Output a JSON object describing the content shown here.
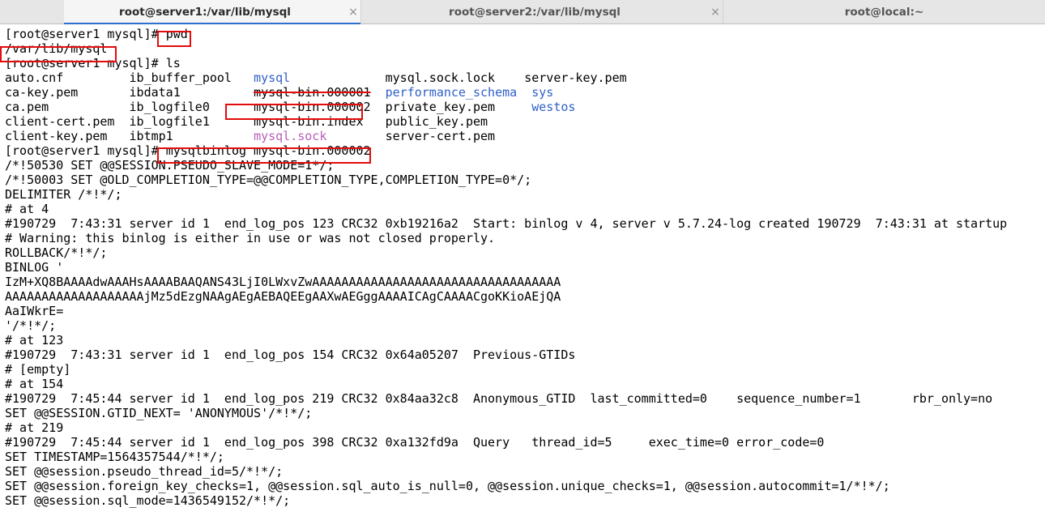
{
  "tabs": {
    "t0": {
      "title": "root@server1:/var/lib/mysql"
    },
    "t1": {
      "title": "root@server2:/var/lib/mysql"
    },
    "t2": {
      "title": "root@local:~"
    },
    "close_glyph": "×"
  },
  "term": {
    "prompt1": "[root@server1 mysql]# ",
    "cmd_pwd": "pwd",
    "pwd_out": "/var/lib/mysql",
    "prompt2": "[root@server1 mysql]# ",
    "cmd_ls": "ls",
    "ls": {
      "r1c1": "auto.cnf",
      "r1c2": "ib_buffer_pool",
      "r1c3": "mysql",
      "r1c4": "mysql.sock.lock",
      "r1c5": "server-key.pem",
      "r2c1": "ca-key.pem",
      "r2c2": "ibdata1",
      "r2c3": "mysql-bin.000001",
      "r2c4": "performance_schema",
      "r2c5": "sys",
      "r3c1": "ca.pem",
      "r3c2": "ib_logfile0",
      "r3c3": "mysql-bin.000002",
      "r3c4": "private_key.pem",
      "r3c5": "westos",
      "r4c1": "client-cert.pem",
      "r4c2": "ib_logfile1",
      "r4c3": "mysql-bin.index",
      "r4c4": "public_key.pem",
      "r4c5": "",
      "r5c1": "client-key.pem",
      "r5c2": "ibtmp1",
      "r5c3": "mysql.sock",
      "r5c4": "server-cert.pem",
      "r5c5": ""
    },
    "prompt3": "[root@server1 mysql]# ",
    "cmd_binlog": "mysqlbinlog mysql-bin.000002",
    "out": {
      "l01": "/*!50530 SET @@SESSION.PSEUDO_SLAVE_MODE=1*/;",
      "l02": "/*!50003 SET @OLD_COMPLETION_TYPE=@@COMPLETION_TYPE,COMPLETION_TYPE=0*/;",
      "l03": "DELIMITER /*!*/;",
      "l04": "# at 4",
      "l05": "#190729  7:43:31 server id 1  end_log_pos 123 CRC32 0xb19216a2  Start: binlog v 4, server v 5.7.24-log created 190729  7:43:31 at startup",
      "l06": "# Warning: this binlog is either in use or was not closed properly.",
      "l07": "ROLLBACK/*!*/;",
      "l08": "BINLOG '",
      "l09": "IzM+XQ8BAAAAdwAAAHsAAAABAAQANS43LjI0LWxvZwAAAAAAAAAAAAAAAAAAAAAAAAAAAAAAAAAA",
      "l10": "AAAAAAAAAAAAAAAAAAAjMz5dEzgNAAgAEgAEBAQEEgAAXwAEGggAAAAICAgCAAAACgoKKioAEjQA",
      "l11": "AaIWkrE=",
      "l12": "'/*!*/;",
      "l13": "# at 123",
      "l14": "#190729  7:43:31 server id 1  end_log_pos 154 CRC32 0x64a05207  Previous-GTIDs",
      "l15": "# [empty]",
      "l16": "# at 154",
      "l17": "#190729  7:45:44 server id 1  end_log_pos 219 CRC32 0x84aa32c8  Anonymous_GTID  last_committed=0    sequence_number=1       rbr_only=no",
      "l18": "SET @@SESSION.GTID_NEXT= 'ANONYMOUS'/*!*/;",
      "l19": "# at 219",
      "l20": "#190729  7:45:44 server id 1  end_log_pos 398 CRC32 0xa132fd9a  Query   thread_id=5     exec_time=0 error_code=0",
      "l21": "SET TIMESTAMP=1564357544/*!*/;",
      "l22": "SET @@session.pseudo_thread_id=5/*!*/;",
      "l23": "SET @@session.foreign_key_checks=1, @@session.sql_auto_is_null=0, @@session.unique_checks=1, @@session.autocommit=1/*!*/;",
      "l24": "SET @@session.sql_mode=1436549152/*!*/;"
    }
  }
}
